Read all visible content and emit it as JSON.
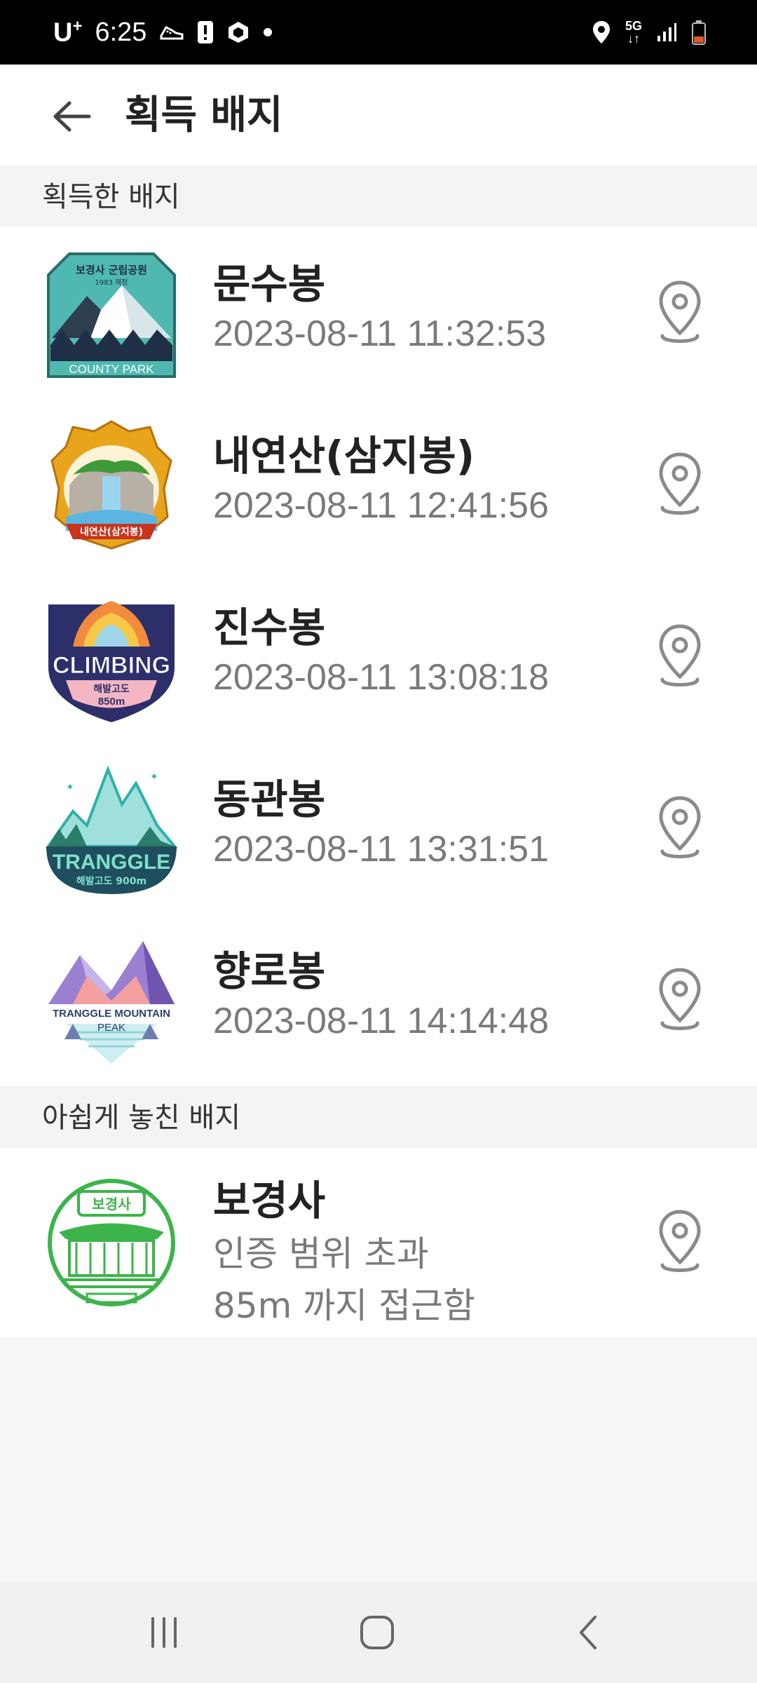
{
  "status_bar": {
    "carrier": "U",
    "carrier_sup": "+",
    "time": "6:25",
    "network": "5G"
  },
  "header": {
    "title": "획득 배지",
    "back_icon": "arrow-left-icon"
  },
  "sections": {
    "earned_label": "획득한 배지",
    "missed_label": "아쉽게 놓친 배지"
  },
  "earned_badges": [
    {
      "name": "문수봉",
      "time": "2023-08-11 11:32:53",
      "badge_text_top": "보경사 군립공원",
      "badge_text_bottom": "COUNTY PARK",
      "badge_year": "1983 제정"
    },
    {
      "name": "내연산(삼지봉)",
      "time": "2023-08-11 12:41:56",
      "badge_text_bottom": "내연산(삼지봉)"
    },
    {
      "name": "진수봉",
      "time": "2023-08-11 13:08:18",
      "badge_text_top": "CLIMBING",
      "badge_text_mid": "해발고도",
      "badge_text_bottom": "850m"
    },
    {
      "name": "동관봉",
      "time": "2023-08-11 13:31:51",
      "badge_text_top": "TRANGGLE",
      "badge_text_bottom": "해발고도 900m"
    },
    {
      "name": "향로봉",
      "time": "2023-08-11 14:14:48",
      "badge_text_top": "TRANGGLE MOUNTAIN",
      "badge_text_bottom": "PEAK"
    }
  ],
  "missed_badges": [
    {
      "name": "보경사",
      "line1": "인증 범위 초과",
      "line2": "85m 까지 접근함",
      "badge_text": "보경사"
    }
  ],
  "colors": {
    "accent_teal": "#4fb9b1",
    "stamp_green": "#3cb44b",
    "pin_gray": "#8a8a8a"
  },
  "icons": {
    "location": "location-pin-icon",
    "nav_recents": "recents-icon",
    "nav_home": "home-icon",
    "nav_back": "back-icon"
  }
}
